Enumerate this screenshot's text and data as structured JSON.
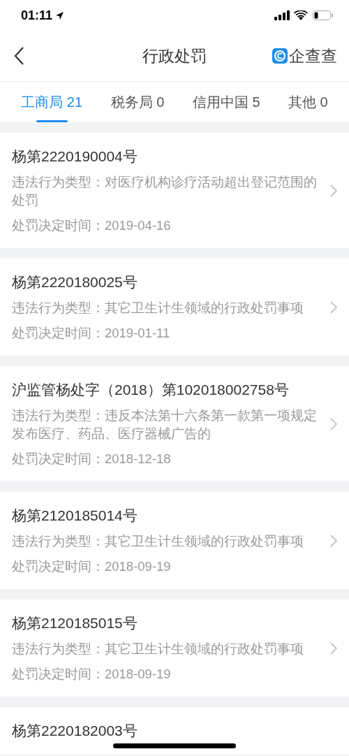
{
  "status_bar": {
    "time": "01:11"
  },
  "nav": {
    "title": "行政处罚",
    "brand": "企查查"
  },
  "tabs": [
    {
      "label": "工商局 21",
      "selected": true
    },
    {
      "label": "税务局 0",
      "selected": false
    },
    {
      "label": "信用中国 5",
      "selected": false
    },
    {
      "label": "其他 0",
      "selected": false
    }
  ],
  "records": [
    {
      "title": "杨第2220190004号",
      "violation": "违法行为类型：对医疗机构诊疗活动超出登记范围的处罚",
      "date": "处罚决定时间：2019-04-16"
    },
    {
      "title": "杨第2220180025号",
      "violation": "违法行为类型：其它卫生计生领域的行政处罚事项",
      "date": "处罚决定时间：2019-01-11"
    },
    {
      "title": "沪监管杨处字（2018）第102018002758号",
      "violation": "违法行为类型：违反本法第十六条第一款第一项规定发布医疗、药品、医疗器械广告的",
      "date": "处罚决定时间：2018-12-18"
    },
    {
      "title": "杨第2120185014号",
      "violation": "违法行为类型：其它卫生计生领域的行政处罚事项",
      "date": "处罚决定时间：2018-09-19"
    },
    {
      "title": "杨第2120185015号",
      "violation": "违法行为类型：其它卫生计生领域的行政处罚事项",
      "date": "处罚决定时间：2018-09-19"
    },
    {
      "title": "杨第2220182003号"
    }
  ]
}
